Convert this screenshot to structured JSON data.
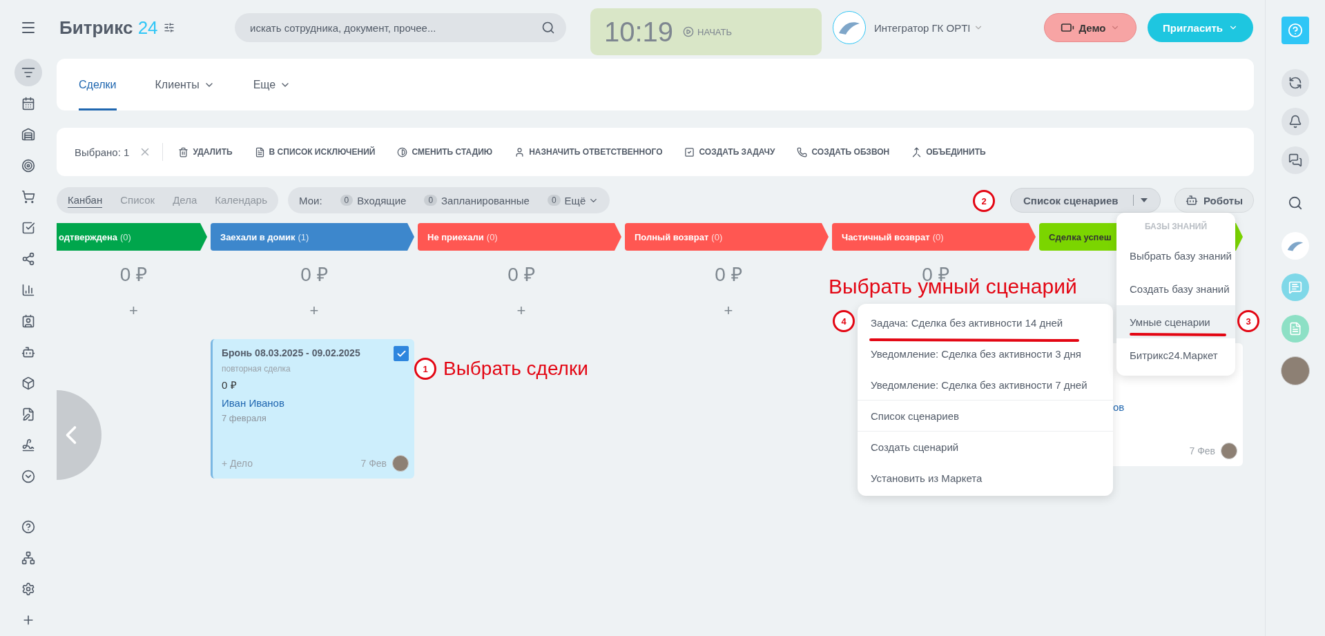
{
  "header": {
    "logo_name": "Битрикс",
    "logo_number": "24",
    "search": {
      "placeholder": "искать сотрудника, документ, прочее..."
    },
    "clock": "10:19",
    "start": "НАЧАТЬ",
    "company": "Интегратор ГК OPTI",
    "demo": "Демо",
    "invite": "Пригласить"
  },
  "tabs": [
    {
      "label": "Сделки",
      "selected": true,
      "dropdown": false
    },
    {
      "label": "Клиенты",
      "selected": false,
      "dropdown": true
    },
    {
      "label": "Еще",
      "selected": false,
      "dropdown": true
    }
  ],
  "action_bar": {
    "selected": "Выбрано: 1",
    "actions": [
      {
        "kind": "trash",
        "label": "УДАЛИТЬ"
      },
      {
        "kind": "doc",
        "label": "В СПИСОК ИСКЛЮЧЕНИЙ"
      },
      {
        "kind": "stage",
        "label": "СМЕНИТЬ СТАДИЮ"
      },
      {
        "kind": "person",
        "label": "НАЗНАЧИТЬ ОТВЕТСТВЕННОГО"
      },
      {
        "kind": "task",
        "label": "СОЗДАТЬ ЗАДАЧУ"
      },
      {
        "kind": "phone",
        "label": "СОЗДАТЬ ОБЗВОН"
      },
      {
        "kind": "merge",
        "label": "ОБЪЕДИНИТЬ"
      }
    ]
  },
  "views": [
    {
      "label": "Канбан",
      "selected": true
    },
    {
      "label": "Список",
      "selected": false
    },
    {
      "label": "Дела",
      "selected": false
    },
    {
      "label": "Календарь",
      "selected": false
    }
  ],
  "counters": {
    "label": "Мои:",
    "items": [
      {
        "count": "0",
        "label": "Входящие",
        "dropdown": false
      },
      {
        "count": "0",
        "label": "Запланированные",
        "dropdown": false
      },
      {
        "count": "0",
        "label": "Ещё",
        "dropdown": true
      }
    ]
  },
  "scenario_button": "Список сценариев",
  "robots_button": "Роботы",
  "stages": [
    {
      "name": "одтверждена",
      "count": "(0)",
      "color": "#00a64c",
      "sum": "0 ₽",
      "add": "+"
    },
    {
      "name": "Заехали в домик",
      "count": "(1)",
      "color": "#3d87cc",
      "sum": "0 ₽",
      "add": "+",
      "cards": [
        {
          "title": "Бронь 08.03.2025 - 09.02.2025",
          "subtitle": "повторная сделка",
          "price": "0 ₽",
          "contact": "Иван Иванов",
          "date": "7 февраля",
          "action": "+ Дело",
          "short_date": "7 Фев",
          "checked": true
        }
      ]
    },
    {
      "name": "Не приехали",
      "count": "(0)",
      "color": "#ff5752",
      "sum": "0 ₽",
      "add": "+"
    },
    {
      "name": "Полный возврат",
      "count": "(0)",
      "color": "#ff5752",
      "sum": "0 ₽",
      "add": "+"
    },
    {
      "name": "Частичный возврат",
      "count": "(0)",
      "color": "#ff5752",
      "sum": "0 ₽"
    },
    {
      "name": "Сделка успеш",
      "color": "#7bd500",
      "cards": [
        {
          "contact": "ов",
          "short_date": "7 Фев"
        }
      ]
    }
  ],
  "scenario_menu": [
    {
      "label": "Задача: Сделка без активности 14 дней",
      "divider_before": false
    },
    {
      "label": "Уведомление: Сделка без активности 3 дня",
      "divider_before": false
    },
    {
      "label": "Уведомление: Сделка без активности 7 дней",
      "divider_before": false
    },
    {
      "label": "Список сценариев",
      "divider_before": true
    },
    {
      "label": "Создать сценарий",
      "divider_before": true
    },
    {
      "label": "Установить из Маркета",
      "divider_before": false
    }
  ],
  "knowledge_menu": {
    "heading": "БАЗЫ ЗНАНИЙ",
    "items": [
      {
        "label": "Выбрать базу знаний",
        "selected": false
      },
      {
        "label": "Создать базу знаний",
        "selected": false
      },
      {
        "label": "Умные сценарии",
        "selected": true
      },
      {
        "label": "Битрикс24.Маркет",
        "selected": false
      }
    ]
  },
  "annotations": {
    "markers": [
      "1",
      "2",
      "3",
      "4"
    ],
    "notes": [
      "Выбрать сделки",
      "Выбрать умный сценарий"
    ]
  }
}
